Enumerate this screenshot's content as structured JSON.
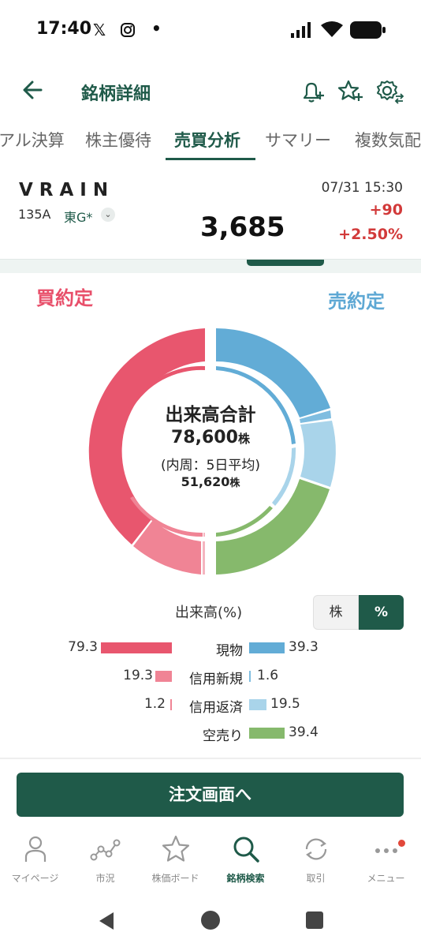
{
  "status_bar": {
    "time": "17:40"
  },
  "app_bar": {
    "title": "銘柄詳細"
  },
  "tabs": [
    {
      "label": "アル決算"
    },
    {
      "label": "株主優待"
    },
    {
      "label": "売買分析"
    },
    {
      "label": "サマリー"
    },
    {
      "label": "複数気配"
    }
  ],
  "stock": {
    "name": "VRAIN",
    "code": "135A",
    "market": "東G*",
    "price": "3,685",
    "datetime": "07/31 15:30",
    "change": "+90",
    "change_pct": "+2.50%"
  },
  "analysis": {
    "buy_label": "買約定",
    "sell_label": "売約定",
    "center": {
      "title": "出来高合計",
      "total": "78,600",
      "total_unit": "株",
      "sub": "(内周：5日平均)",
      "avg": "51,620",
      "avg_unit": "株"
    },
    "legend_title": "出来高(%)",
    "toggle": {
      "shares": "株",
      "percent": "%"
    },
    "rows": [
      {
        "category": "現物",
        "buy": "79.3",
        "sell": "39.3"
      },
      {
        "category": "信用新規",
        "buy": "19.3",
        "sell": "1.6"
      },
      {
        "category": "信用返済",
        "buy": "1.2",
        "sell": "19.5"
      },
      {
        "category": "空売り",
        "buy": "",
        "sell": "39.4"
      }
    ],
    "colors": {
      "buy_cash": "#e8566e",
      "buy_margin_new": "#f08495",
      "buy_margin_repay": "#f5b5bf",
      "sell_cash": "#62acd6",
      "sell_margin_new": "#7fbde0",
      "sell_margin_repay": "#a9d4ea",
      "short": "#86b96c"
    }
  },
  "order_button": {
    "label": "注文画面へ"
  },
  "bottom_nav": [
    {
      "label": "マイページ"
    },
    {
      "label": "市況"
    },
    {
      "label": "株価ボード"
    },
    {
      "label": "銘柄検索"
    },
    {
      "label": "取引"
    },
    {
      "label": "メニュー"
    }
  ]
}
